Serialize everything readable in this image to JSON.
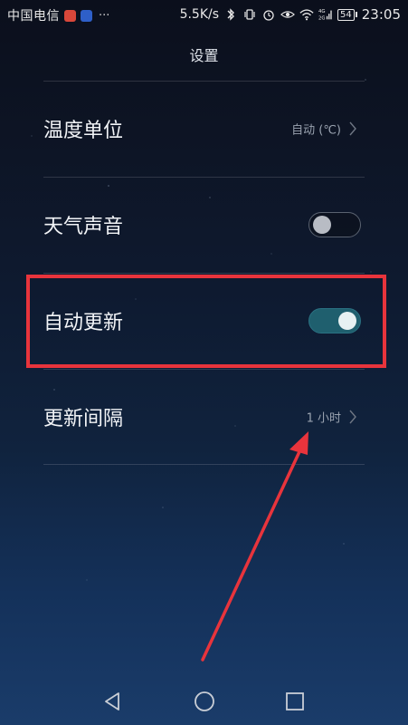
{
  "status_bar": {
    "carrier": "中国电信",
    "network_speed": "5.5K/s",
    "signal_label": "4G\n2G",
    "battery": "54",
    "time": "23:05",
    "more_indicator": "···"
  },
  "header": {
    "title": "设置"
  },
  "settings": {
    "temperature_unit": {
      "label": "温度单位",
      "value": "自动 (℃)"
    },
    "weather_sound": {
      "label": "天气声音",
      "enabled": false
    },
    "auto_update": {
      "label": "自动更新",
      "enabled": true
    },
    "update_interval": {
      "label": "更新间隔",
      "value": "1 小时"
    }
  },
  "colors": {
    "accent_toggle_on": "#1f5f6e",
    "highlight": "#e8343c",
    "background_top": "#0b0f1c",
    "background_bottom": "#1a3c6a"
  },
  "icons": {
    "status": [
      "mail-notification-icon",
      "app-notification-icon",
      "bluetooth-icon",
      "vibrate-icon",
      "alarm-icon",
      "eye-icon",
      "wifi-icon",
      "signal-icon",
      "battery-icon"
    ],
    "nav": [
      "back-icon",
      "home-icon",
      "recents-icon"
    ],
    "row": "chevron-right-icon"
  }
}
